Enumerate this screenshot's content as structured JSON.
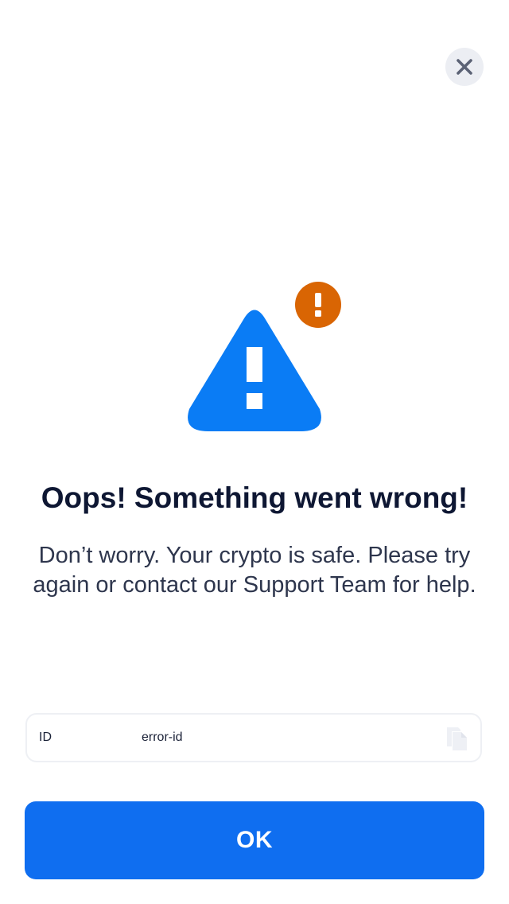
{
  "header": {
    "close_icon": "close-icon"
  },
  "illustration": {
    "icon": "warning-triangle-icon",
    "badge_icon": "exclamation-badge-icon",
    "triangle_color": "#0a7cf5",
    "badge_color": "#d96503"
  },
  "content": {
    "title": "Oops! Something went wrong!",
    "message": "Don’t worry. Your crypto is safe. Please try again or contact our Support Team for help."
  },
  "error_info": {
    "label": "ID",
    "value": "error-id",
    "copy_icon": "copy-icon"
  },
  "actions": {
    "ok_label": "OK",
    "ok_color": "#0f6ef0"
  }
}
